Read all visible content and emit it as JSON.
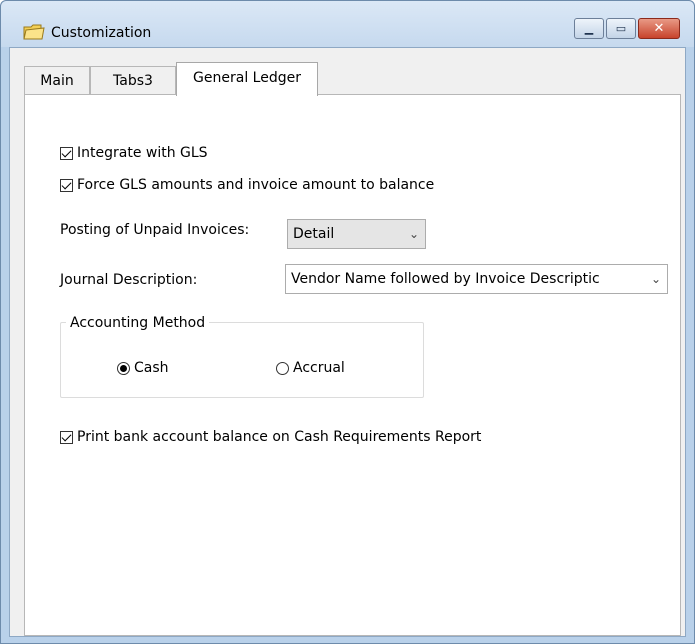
{
  "window": {
    "title": "Customization",
    "icon": "folder-note-icon",
    "controls": {
      "minimize": "▁",
      "maximize": "▭",
      "close": "✕"
    }
  },
  "tabs": [
    {
      "label": "Main",
      "active": false
    },
    {
      "label": "Tabs3",
      "active": false
    },
    {
      "label": "General Ledger",
      "active": true
    }
  ],
  "general_ledger": {
    "integrate_gls": {
      "label": "Integrate with GLS",
      "checked": true
    },
    "force_balance": {
      "label": "Force GLS amounts and invoice amount to balance",
      "checked": true
    },
    "posting_unpaid": {
      "label": "Posting of Unpaid Invoices:",
      "value": "Detail"
    },
    "journal_description": {
      "label": "Journal Description:",
      "value": "Vendor Name followed by Invoice Descriptic"
    },
    "accounting_method": {
      "legend": "Accounting Method",
      "options": [
        {
          "label": "Cash",
          "checked": true
        },
        {
          "label": "Accrual",
          "checked": false
        }
      ]
    },
    "print_bank_balance": {
      "label": "Print bank account balance on Cash Requirements Report",
      "checked": true
    }
  },
  "colors": {
    "frame": "#b9d1ea",
    "panel": "#ffffff",
    "close_button": "#c7432c"
  }
}
